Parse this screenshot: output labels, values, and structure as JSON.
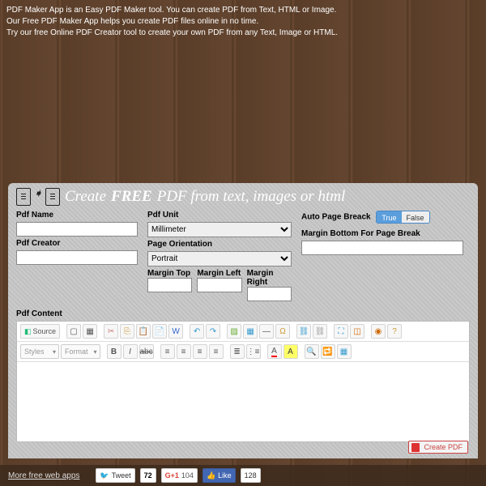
{
  "intro": {
    "l1": "PDF Maker App is an Easy PDF Maker tool. You can create PDF from Text, HTML or Image.",
    "l2": "Our Free PDF Maker App helps you create PDF files online in no time.",
    "l3": "Try our free Online PDF Creator tool to create your own PDF from any Text, Image or HTML."
  },
  "header": {
    "prefix": "Create",
    "free": "FREE",
    "suffix": "PDF from text, images or html"
  },
  "labels": {
    "pdfName": "Pdf Name",
    "pdfCreator": "Pdf Creator",
    "pdfUnit": "Pdf Unit",
    "pageOrientation": "Page Orientation",
    "marginTop": "Margin Top",
    "marginLeft": "Margin Left",
    "marginRight": "Margin Right",
    "autoPageBreak": "Auto Page Breack",
    "marginBottom": "Margin Bottom For Page Break",
    "pdfContent": "Pdf Content"
  },
  "values": {
    "pdfName": "",
    "pdfCreator": "",
    "pdfUnit": "Millimeter",
    "pageOrientation": "Portrait",
    "marginTop": "",
    "marginLeft": "",
    "marginRight": "",
    "autoPageBreakTrue": "True",
    "autoPageBreakFalse": "False",
    "marginBottom": ""
  },
  "toolbar": {
    "source": "Source",
    "styles": "Styles",
    "format": "Format"
  },
  "buttons": {
    "create": "Create PDF"
  },
  "footer": {
    "more": "More free web apps",
    "tweet": "Tweet",
    "tweetCount": "72",
    "gplus": "G+1",
    "gplusCount": "104",
    "fbLike": "Like",
    "fbCount": "128"
  }
}
